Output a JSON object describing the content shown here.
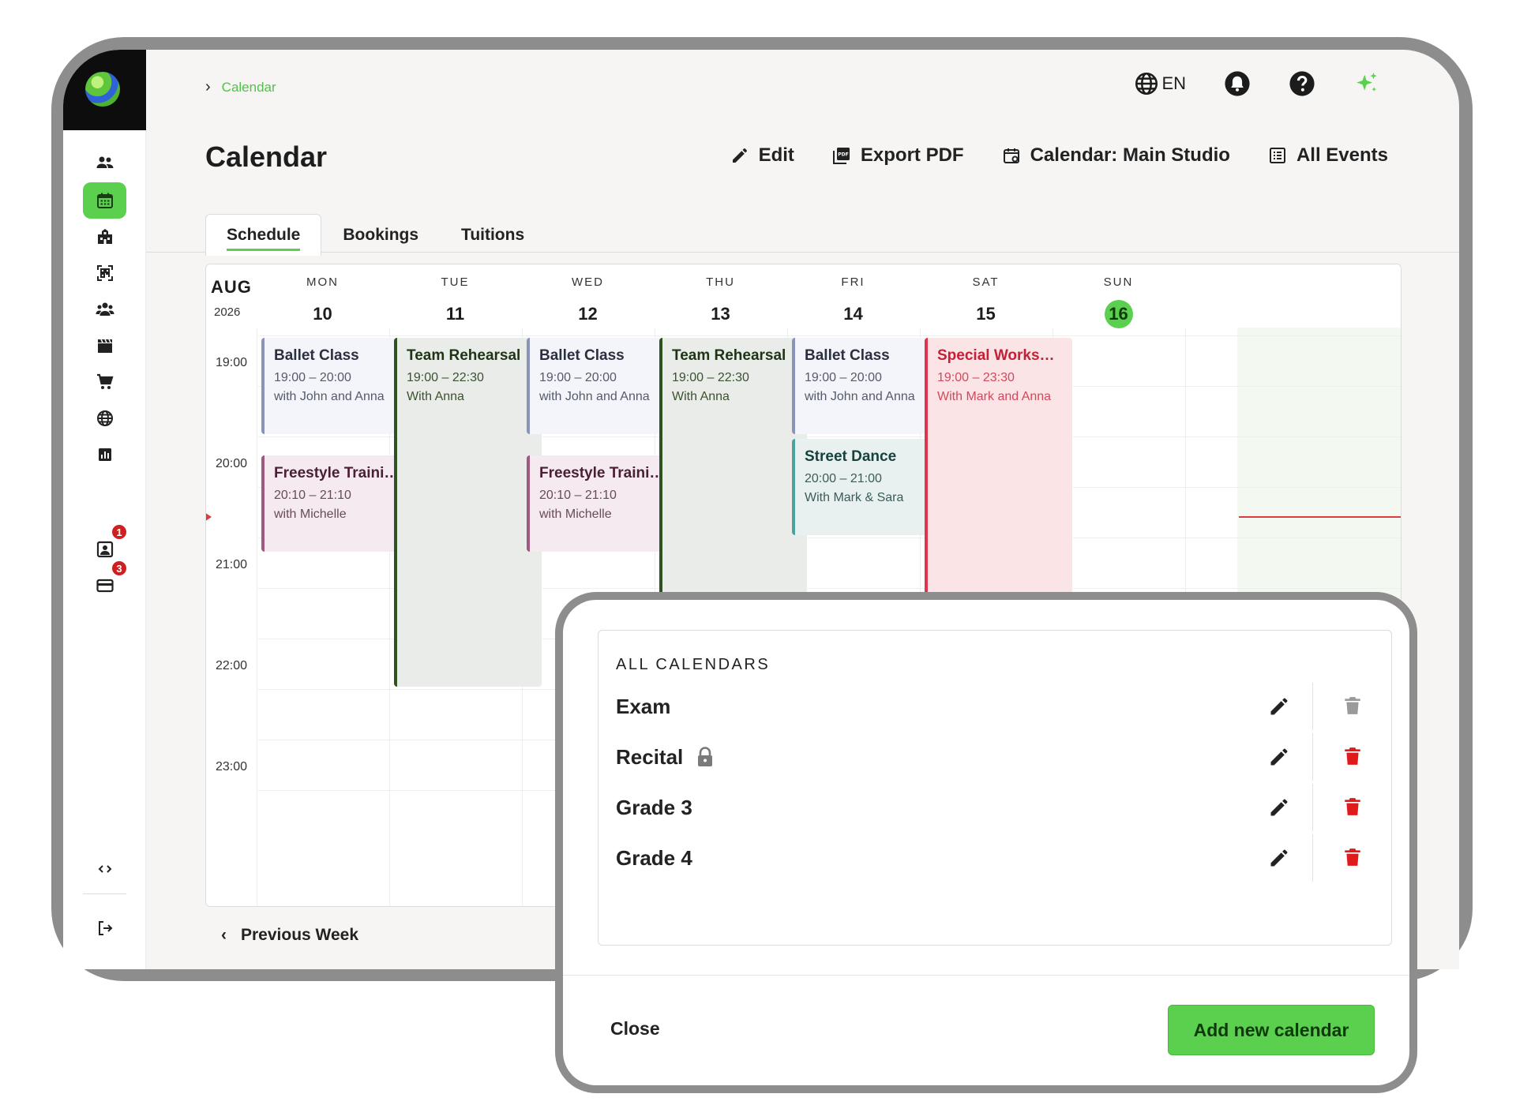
{
  "breadcrumb": {
    "current": "Calendar"
  },
  "topbar": {
    "language": "EN"
  },
  "page": {
    "title": "Calendar"
  },
  "actions": {
    "edit": "Edit",
    "export": "Export PDF",
    "calendar": "Calendar: Main Studio",
    "all_events": "All Events"
  },
  "tabs": [
    {
      "label": "Schedule",
      "active": true
    },
    {
      "label": "Bookings",
      "active": false
    },
    {
      "label": "Tuitions",
      "active": false
    }
  ],
  "sidebar": {
    "icons": [
      "people-icon",
      "calendar-icon",
      "building-icon",
      "qr-scan-icon",
      "group-icon",
      "clapperboard-icon",
      "cart-icon",
      "globe-icon",
      "chart-icon",
      "contact-card-icon",
      "credit-card-icon",
      "code-icon",
      "logout-icon"
    ],
    "badges": {
      "contacts": "1",
      "payments": "3"
    }
  },
  "calendar": {
    "month": "AUG",
    "year": "2026",
    "days": [
      {
        "name": "MON",
        "date": "10",
        "today": false
      },
      {
        "name": "TUE",
        "date": "11",
        "today": false
      },
      {
        "name": "WED",
        "date": "12",
        "today": false
      },
      {
        "name": "THU",
        "date": "13",
        "today": false
      },
      {
        "name": "FRI",
        "date": "14",
        "today": false
      },
      {
        "name": "SAT",
        "date": "15",
        "today": false
      },
      {
        "name": "SUN",
        "date": "16",
        "today": true
      }
    ],
    "hours": [
      "19:00",
      "20:00",
      "21:00",
      "22:00",
      "23:00"
    ],
    "events": [
      {
        "title": "Ballet Class",
        "time": "19:00 – 20:00",
        "with": "with John and Anna",
        "day": 0,
        "kind": "ballet"
      },
      {
        "title": "Freestyle Training",
        "time": "20:10 – 21:10",
        "with": "with Michelle",
        "day": 0,
        "kind": "free"
      },
      {
        "title": "Team Rehearsal",
        "time": "19:00 – 22:30",
        "with": "With Anna",
        "day": 1,
        "kind": "team"
      },
      {
        "title": "Ballet Class",
        "time": "19:00 – 20:00",
        "with": "with John and Anna",
        "day": 2,
        "kind": "ballet"
      },
      {
        "title": "Freestyle Training",
        "time": "20:10 – 21:10",
        "with": "with Michelle",
        "day": 2,
        "kind": "free"
      },
      {
        "title": "Team Rehearsal",
        "time": "19:00 – 22:30",
        "with": "With Anna",
        "day": 3,
        "kind": "team"
      },
      {
        "title": "Ballet Class",
        "time": "19:00 – 20:00",
        "with": "with John and Anna",
        "day": 4,
        "kind": "ballet"
      },
      {
        "title": "Street Dance",
        "time": "20:00 – 21:00",
        "with": "With Mark & Sara",
        "day": 4,
        "kind": "street"
      },
      {
        "title": "Special Workshop",
        "time": "19:00 – 23:30",
        "with": "With Mark and Anna",
        "day": 5,
        "kind": "special"
      }
    ]
  },
  "footer": {
    "previous_week": "Previous Week"
  },
  "modal": {
    "heading": "ALL CALENDARS",
    "calendars": [
      {
        "name": "Exam",
        "locked": false,
        "deletable": false
      },
      {
        "name": "Recital",
        "locked": true,
        "deletable": true
      },
      {
        "name": "Grade 3",
        "locked": false,
        "deletable": true
      },
      {
        "name": "Grade 4",
        "locked": false,
        "deletable": true
      }
    ],
    "close_label": "Close",
    "add_label": "Add new calendar"
  },
  "colors": {
    "accent": "#5bd04f",
    "danger": "#e01b1b",
    "special": "#e2334c"
  }
}
